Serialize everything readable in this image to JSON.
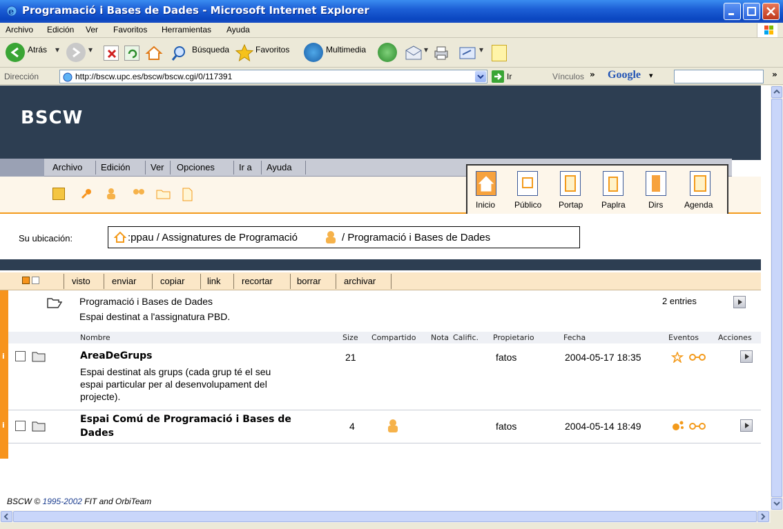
{
  "window": {
    "title": "Programació i Bases de Dades - Microsoft Internet Explorer"
  },
  "menu": [
    "Archivo",
    "Edición",
    "Ver",
    "Favoritos",
    "Herramientas",
    "Ayuda"
  ],
  "toolbar": {
    "back": "Atrás",
    "search": "Búsqueda",
    "favorites": "Favoritos",
    "media": "Multimedia"
  },
  "address": {
    "label": "Dirección",
    "url": "http://bscw.upc.es/bscw/bscw.cgi/0/117391",
    "go": "Ir",
    "links": "Vínculos",
    "google": "Google"
  },
  "bscw": {
    "logo": "BSCW",
    "menu": [
      "Archivo",
      "Edición",
      "Ver",
      "Opciones",
      "Ir a",
      "Ayuda"
    ],
    "nav": [
      "Inicio",
      "Público",
      "Portap",
      "Paplra",
      "Dirs",
      "Agenda"
    ],
    "location_label": "Su ubicación:",
    "loc_part1": ":ppau / Assignatures de Programació",
    "loc_part2": "/ Programació i Bases de Dades",
    "actions": [
      "visto",
      "enviar",
      "copiar",
      "link",
      "recortar",
      "borrar",
      "archivar"
    ],
    "folder_title": "Programació i Bases de Dades",
    "folder_desc": "Espai destinat a l'assignatura PBD.",
    "entries": "2 entries",
    "columns": [
      "Nombre",
      "Size",
      "Compartido",
      "Nota",
      "Calific.",
      "Propietario",
      "Fecha",
      "Eventos",
      "Acciones"
    ],
    "rows": [
      {
        "badge": "i",
        "name": "AreaDeGrups",
        "desc1": "Espai destinat als grups (cada grup té el seu",
        "desc2": "espai particular per al desenvolupament del",
        "desc3": "projecte).",
        "size": "21",
        "owner": "fatos",
        "date": "2004-05-17 18:35"
      },
      {
        "badge": "i",
        "name1": "Espai Comú de Programació i Bases de",
        "name2": "Dades",
        "size": "4",
        "owner": "fatos",
        "date": "2004-05-14 18:49"
      }
    ],
    "footer_a": "BSCW ©",
    "footer_b": "1995-2002",
    "footer_c": "FIT",
    "footer_d": "and",
    "footer_e": "OrbiTeam"
  },
  "colors": {
    "accent": "#f7941d",
    "banner": "#2d3e52",
    "xpblue": "#0a46c0"
  }
}
